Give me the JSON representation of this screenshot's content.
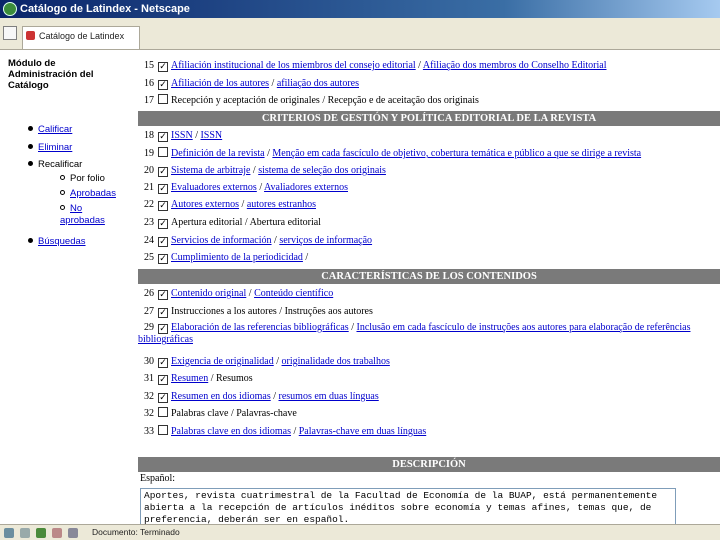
{
  "window": {
    "title": "Catálogo de Latindex - Netscape"
  },
  "tabs": [
    {
      "label": "Catálogo de Latindex"
    }
  ],
  "sidebar": {
    "title": "Módulo de Administración del Catálogo",
    "items": [
      {
        "label": "Calificar"
      },
      {
        "label": "Eliminar"
      },
      {
        "label": "Recalificar"
      },
      {
        "label": "Por folio"
      },
      {
        "label": "Aprobadas"
      },
      {
        "label": "No aprobadas"
      },
      {
        "label": "Búsquedas"
      }
    ]
  },
  "content": {
    "cutoff_text": "—— — — ——— —— —— ——— ——— ——— ——— —— —— ——",
    "rows_top": [
      {
        "num": "15",
        "checked": true,
        "link": "Afiliación institucional de los miembros del consejo editorial",
        "text": " / ",
        "link2": "Afiliação dos membros do Conselho Editorial"
      },
      {
        "num": "16",
        "checked": true,
        "link": "Afiliación de los autores",
        "text": " / ",
        "link2": "afiliação dos autores"
      },
      {
        "num": "17",
        "checked": false,
        "link": "",
        "text": "Recepción y aceptación de originales / Recepção e de aceitação dos originais",
        "link2": ""
      }
    ],
    "section1": "CRITERIOS DE GESTIÓN Y POLÍTICA EDITORIAL DE LA REVISTA",
    "rows_s1": [
      {
        "num": "18",
        "checked": true,
        "link": "ISSN",
        "text": " / ",
        "link2": "ISSN"
      },
      {
        "num": "19",
        "checked": false,
        "link": "Definición de la revista",
        "text": " / ",
        "link2": "Menção em cada fascículo de objetivo, cobertura temática e público a que se dirige a revista"
      },
      {
        "num": "20",
        "checked": true,
        "link": "Sistema de arbitraje",
        "text": " / ",
        "link2": "sistema de seleção dos originais"
      },
      {
        "num": "21",
        "checked": true,
        "link": "Evaluadores externos",
        "text": " / ",
        "link2": "Avaliadores externos"
      },
      {
        "num": "22",
        "checked": true,
        "link": "Autores externos",
        "text": " / ",
        "link2": "autores estranhos"
      },
      {
        "num": "23",
        "checked": true,
        "link": "",
        "text": "Apertura editorial / Abertura editorial",
        "link2": ""
      },
      {
        "num": "24",
        "checked": true,
        "link": "Servicios de información",
        "text": " / ",
        "link2": "serviços de informação"
      },
      {
        "num": "25",
        "checked": true,
        "link": "Cumplimiento de la periodicidad",
        "text": " /",
        "link2": ""
      }
    ],
    "section2": "CARACTERÍSTICAS DE LOS CONTENIDOS",
    "rows_s2": [
      {
        "num": "26",
        "checked": true,
        "link": "Contenido original",
        "text": " / ",
        "link2": "Conteúdo científico"
      },
      {
        "num": "27",
        "checked": true,
        "link": "",
        "text": "Instrucciones a los autores / Instruções aos autores",
        "link2": ""
      },
      {
        "num": "29",
        "checked": true,
        "link": "Elaboración de las referencias bibliográficas",
        "text": " / ",
        "link2": "Inclusão em cada fascículo de instruções aos autores para elaboração de referências bibliográficas"
      },
      {
        "num": "30",
        "checked": true,
        "link": "Exigencia de originalidad",
        "text": " / ",
        "link2": "originalidade dos trabalhos"
      },
      {
        "num": "31",
        "checked": true,
        "link": "Resumen",
        "text": " / Resumos",
        "link2": ""
      },
      {
        "num": "32",
        "checked": true,
        "link": "Resumen en dos idiomas",
        "text": " / ",
        "link2": "resumos em duas línguas"
      },
      {
        "num": "32",
        "checked": false,
        "link": "",
        "text": "Palabras clave / Palavras-chave",
        "link2": ""
      },
      {
        "num": "33",
        "checked": false,
        "link": "Palabras clave en dos idiomas",
        "text": " / ",
        "link2": "Palavras-chave em duas línguas"
      }
    ],
    "section3": "DESCRIPCIÓN",
    "desc_label": "Español:",
    "desc_text": "Aportes, revista cuatrimestral de la Facultad de Economía de la BUAP, está permanentemente abierta a la recepción de artículos inéditos sobre economía y temas afines, temas que, de preferencia, deberán ser en español."
  },
  "status": {
    "text": "Documento: Terminado"
  },
  "colors": {
    "titlebar": "#0a246a",
    "section_header": "#7a7a7a",
    "link": "#0000cc"
  }
}
